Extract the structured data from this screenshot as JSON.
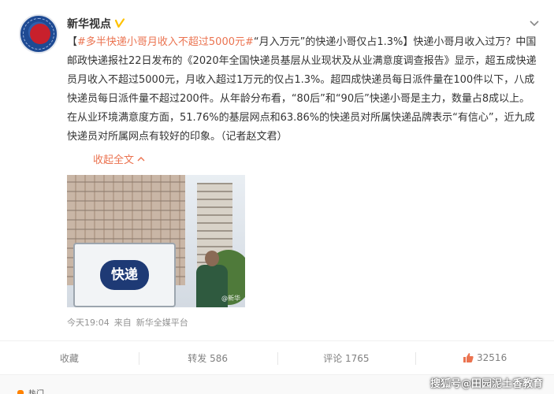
{
  "post": {
    "author": "新华视点",
    "topic_tag": "#多半快递小哥月收入不超过5000元#",
    "text_segments": [
      "“月入万元”的快递小哥仅占1.3%】快递小哥月收入过万？中国邮政快递报社22日发布的《2020年全国快递员基层从业现状及从业满意度调查报告》显示，超五成快递员月收入不超过5000元，月收入超过1万元的仅占1.3%。超四成快递员每日派件量在100件以下，八成快递员每日派件量不超过200件。从年龄分布看，“80后”和“90后”快递小哥是主力，数量占8成以上。在从业环境满意度方面，51.76%的基层网点和63.86%的快递员对所属快递品牌表示“有信心”，近九成快递员对所属网点有较好的印象。（记者赵文君）"
    ],
    "open_bracket": "【",
    "collapse_label": "收起全文",
    "image": {
      "sign_text": "快递",
      "watermark": "@新华"
    },
    "meta": {
      "time": "今天19:04",
      "source_prefix": "来自",
      "source": "新华全媒平台"
    }
  },
  "actions": {
    "favorite": "收藏",
    "repost": "转发 586",
    "comment": "评论 1765",
    "likes": "32516"
  },
  "footer": {
    "label": "热门"
  },
  "watermark_text": "搜狐号@田园泥土香教育",
  "colors": {
    "topic": "#eb7350",
    "verified": "#ffc200",
    "like": "#eb7350"
  }
}
